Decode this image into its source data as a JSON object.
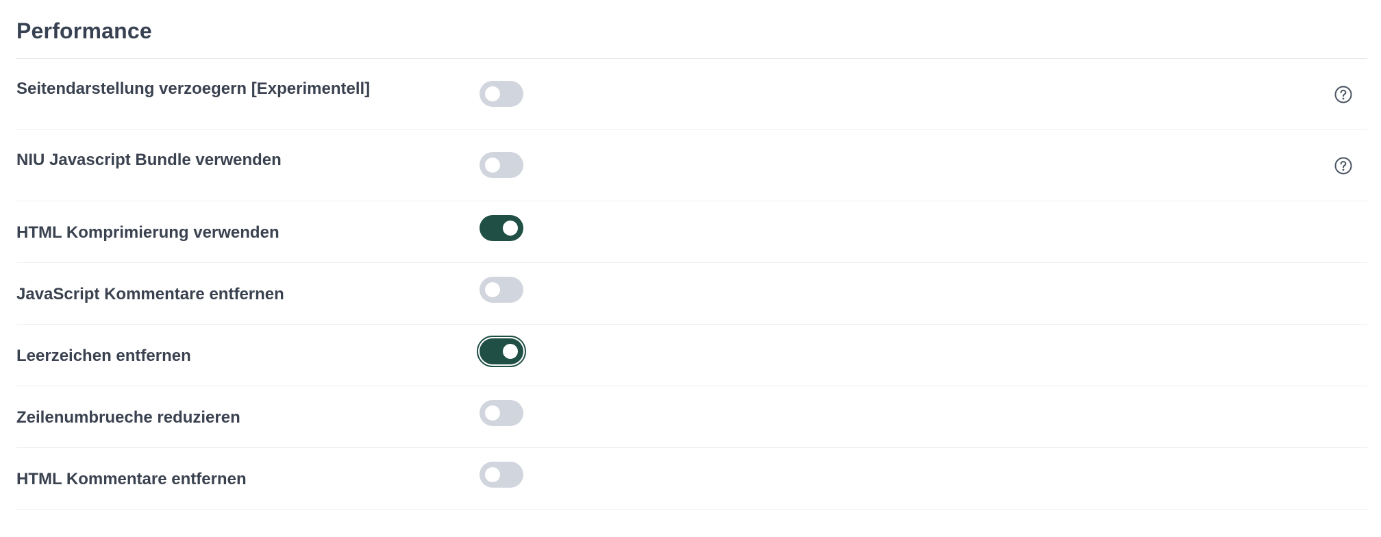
{
  "section": {
    "title": "Performance"
  },
  "settings": [
    {
      "label": "Seitendarstellung verzoegern [Experimentell]",
      "enabled": false,
      "help": true,
      "help_icon": "question-circle-icon"
    },
    {
      "label": "NIU Javascript Bundle verwenden",
      "enabled": false,
      "help": true,
      "help_icon": "question-circle-icon"
    },
    {
      "label": "HTML Komprimierung verwenden",
      "enabled": true,
      "help": false
    },
    {
      "label": "JavaScript Kommentare entfernen",
      "enabled": false,
      "help": false
    },
    {
      "label": "Leerzeichen entfernen",
      "enabled": true,
      "focused": true,
      "help": false
    },
    {
      "label": "Zeilenumbrueche reduzieren",
      "enabled": false,
      "help": false
    },
    {
      "label": "HTML Kommentare entfernen",
      "enabled": false,
      "help": false
    }
  ],
  "colors": {
    "toggle_on": "#1f4f45",
    "toggle_off": "#d1d5de",
    "text": "#374151"
  }
}
